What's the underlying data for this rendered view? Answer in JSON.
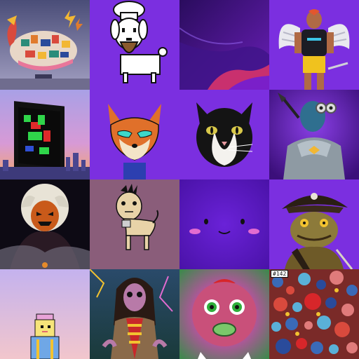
{
  "grid": {
    "tiles": [
      {
        "name": "whale-art-tile"
      },
      {
        "name": "chef-goat-tile"
      },
      {
        "name": "abstract-purple-tile"
      },
      {
        "name": "winged-man-tile"
      },
      {
        "name": "pixel-monitor-tile"
      },
      {
        "name": "fox-tile"
      },
      {
        "name": "cat-tile"
      },
      {
        "name": "blue-robot-tile"
      },
      {
        "name": "horned-demon-tile"
      },
      {
        "name": "mohawk-dog-tile"
      },
      {
        "name": "purple-face-tile"
      },
      {
        "name": "pirate-toad-tile"
      },
      {
        "name": "pixel-kid-tile"
      },
      {
        "name": "long-hair-man-tile"
      },
      {
        "name": "green-eyed-creature-tile"
      },
      {
        "name": "dots-pattern-tile",
        "badge": "#142"
      }
    ]
  },
  "colors": {
    "accent_purple": "#7b2fe0",
    "deep_purple": "#3b0f7a",
    "sky_lavender": "#b9a6e6"
  }
}
